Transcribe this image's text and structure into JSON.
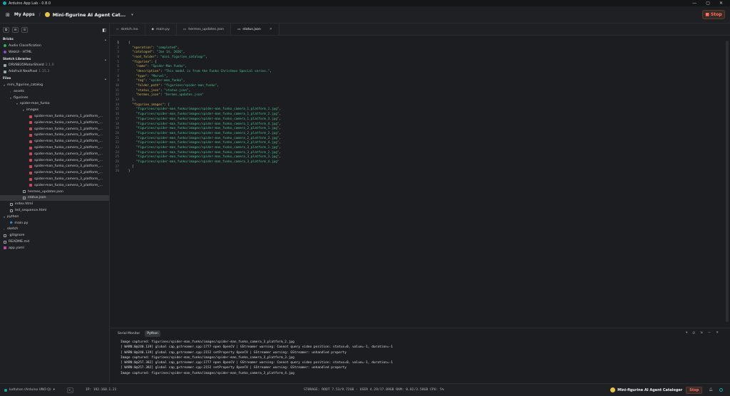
{
  "window": {
    "title": "Arduino App Lab - 0.8.0"
  },
  "appbar": {
    "my_apps": "My Apps",
    "separator": "/",
    "app_title": "Mini-figurine AI Agent Cat...",
    "stop_label": "Stop"
  },
  "sidebar": {
    "tools": [
      "⧉",
      "⊟",
      "⊡"
    ],
    "bricks_header": "Bricks",
    "bricks": [
      {
        "label": "Audio Classification",
        "color": "#2fb35c"
      },
      {
        "label": "WebUI - HTML",
        "color": "#8a4fd1"
      }
    ],
    "libraries_header": "Sketch Libraries",
    "libraries": [
      {
        "label": "DRV8835MotorShield",
        "version": "2.1.0"
      },
      {
        "label": "Adafruit NeoPixel",
        "version": "1.15.3"
      }
    ],
    "files_header": "Files",
    "tree": [
      {
        "label": "mini_figurine_catalog",
        "depth": 0,
        "toggle": "▾",
        "icon": "none"
      },
      {
        "label": "assets",
        "depth": 1,
        "toggle": "›",
        "icon": "none"
      },
      {
        "label": "figurines",
        "depth": 1,
        "toggle": "▾",
        "icon": "none"
      },
      {
        "label": "spider-man_funko",
        "depth": 2,
        "toggle": "▾",
        "icon": "none"
      },
      {
        "label": "images",
        "depth": 3,
        "toggle": "▾",
        "icon": "none"
      },
      {
        "label": "spider-man_funko_camera_1_platform_...",
        "depth": 4,
        "toggle": "",
        "icon": "img"
      },
      {
        "label": "spider-man_funko_camera_1_platform_...",
        "depth": 4,
        "toggle": "",
        "icon": "img"
      },
      {
        "label": "spider-man_funko_camera_1_platform_...",
        "depth": 4,
        "toggle": "",
        "icon": "img"
      },
      {
        "label": "spider-man_funko_camera_1_platform_...",
        "depth": 4,
        "toggle": "",
        "icon": "img"
      },
      {
        "label": "spider-man_funko_camera_2_platform_...",
        "depth": 4,
        "toggle": "",
        "icon": "img"
      },
      {
        "label": "spider-man_funko_camera_2_platform_...",
        "depth": 4,
        "toggle": "",
        "icon": "img"
      },
      {
        "label": "spider-man_funko_camera_2_platform_...",
        "depth": 4,
        "toggle": "",
        "icon": "img"
      },
      {
        "label": "spider-man_funko_camera_2_platform_...",
        "depth": 4,
        "toggle": "",
        "icon": "img"
      },
      {
        "label": "spider-man_funko_camera_3_platform_...",
        "depth": 4,
        "toggle": "",
        "icon": "img"
      },
      {
        "label": "spider-man_funko_camera_3_platform_...",
        "depth": 4,
        "toggle": "",
        "icon": "img"
      },
      {
        "label": "spider-man_funko_camera_3_platform_...",
        "depth": 4,
        "toggle": "",
        "icon": "img"
      },
      {
        "label": "spider-man_funko_camera_3_platform_...",
        "depth": 4,
        "toggle": "",
        "icon": "img"
      },
      {
        "label": "hermes_updates.json",
        "depth": 3,
        "toggle": "",
        "icon": "file"
      },
      {
        "label": "status.json",
        "depth": 3,
        "toggle": "",
        "icon": "file",
        "selected": true
      },
      {
        "label": "index.html",
        "depth": 1,
        "toggle": "",
        "icon": "file"
      },
      {
        "label": "led_sequence.html",
        "depth": 1,
        "toggle": "",
        "icon": "file"
      },
      {
        "label": "python",
        "depth": 0,
        "toggle": "▾",
        "icon": "none"
      },
      {
        "label": "main.py",
        "depth": 1,
        "toggle": "",
        "icon": "py"
      },
      {
        "label": "sketch",
        "depth": 0,
        "toggle": "›",
        "icon": "none"
      },
      {
        "label": ".gitignore",
        "depth": 0,
        "toggle": "",
        "icon": "file"
      },
      {
        "label": "README.md",
        "depth": 0,
        "toggle": "",
        "icon": "file"
      },
      {
        "label": "app.yaml",
        "depth": 0,
        "toggle": "",
        "icon": "yaml"
      }
    ]
  },
  "tabs": [
    {
      "label": "sketch.ino",
      "icon": "‹›",
      "active": false
    },
    {
      "label": "main.py",
      "icon": "◆",
      "active": false
    },
    {
      "label": "hermes_updates.json",
      "icon": "▭",
      "active": false
    },
    {
      "label": "status.json",
      "icon": "▭",
      "active": true
    }
  ],
  "code_lines": [
    [
      {
        "t": "{",
        "c": "p"
      }
    ],
    [
      {
        "t": "  ",
        "c": "p"
      },
      {
        "t": "\"operation\"",
        "c": "k"
      },
      {
        "t": ": ",
        "c": "p"
      },
      {
        "t": "\"completed\"",
        "c": "s"
      },
      {
        "t": ",",
        "c": "p"
      }
    ],
    [
      {
        "t": "  ",
        "c": "p"
      },
      {
        "t": "\"cataloged\"",
        "c": "k"
      },
      {
        "t": ": ",
        "c": "p"
      },
      {
        "t": "\"Jan 14, 2026\"",
        "c": "s"
      },
      {
        "t": ",",
        "c": "p"
      }
    ],
    [
      {
        "t": "  ",
        "c": "p"
      },
      {
        "t": "\"root_folder\"",
        "c": "k"
      },
      {
        "t": ": ",
        "c": "p"
      },
      {
        "t": "\"mini_figurine_catalog/\"",
        "c": "s"
      },
      {
        "t": ",",
        "c": "p"
      }
    ],
    [
      {
        "t": "  ",
        "c": "p"
      },
      {
        "t": "\"figurine\"",
        "c": "k"
      },
      {
        "t": ": {",
        "c": "p"
      }
    ],
    [
      {
        "t": "    ",
        "c": "p"
      },
      {
        "t": "\"name\"",
        "c": "k"
      },
      {
        "t": ": ",
        "c": "p"
      },
      {
        "t": "\"Spider-Man Funko\"",
        "c": "s"
      },
      {
        "t": ",",
        "c": "p"
      }
    ],
    [
      {
        "t": "    ",
        "c": "p"
      },
      {
        "t": "\"description\"",
        "c": "k"
      },
      {
        "t": ": ",
        "c": "p"
      },
      {
        "t": "\"This model is from the Funko Christmas Special series.\"",
        "c": "s"
      },
      {
        "t": ",",
        "c": "p"
      }
    ],
    [
      {
        "t": "    ",
        "c": "p"
      },
      {
        "t": "\"type\"",
        "c": "k"
      },
      {
        "t": ": ",
        "c": "p"
      },
      {
        "t": "\"Marvel\"",
        "c": "s"
      },
      {
        "t": ",",
        "c": "p"
      }
    ],
    [
      {
        "t": "    ",
        "c": "p"
      },
      {
        "t": "\"tag\"",
        "c": "k"
      },
      {
        "t": ": ",
        "c": "p"
      },
      {
        "t": "\"spider-man_funko\"",
        "c": "s"
      },
      {
        "t": ",",
        "c": "p"
      }
    ],
    [
      {
        "t": "    ",
        "c": "p"
      },
      {
        "t": "\"folder_path\"",
        "c": "k"
      },
      {
        "t": ": ",
        "c": "p"
      },
      {
        "t": "\"figurines/spider-man_funko\"",
        "c": "s"
      },
      {
        "t": ",",
        "c": "p"
      }
    ],
    [
      {
        "t": "    ",
        "c": "p"
      },
      {
        "t": "\"status_json\"",
        "c": "k"
      },
      {
        "t": ": ",
        "c": "p"
      },
      {
        "t": "\"status.json\"",
        "c": "s"
      },
      {
        "t": ",",
        "c": "p"
      }
    ],
    [
      {
        "t": "    ",
        "c": "p"
      },
      {
        "t": "\"hermes_json\"",
        "c": "k"
      },
      {
        "t": ": ",
        "c": "p"
      },
      {
        "t": "\"hermes_updates.json\"",
        "c": "s"
      }
    ],
    [
      {
        "t": "  },",
        "c": "p"
      }
    ],
    [
      {
        "t": "  ",
        "c": "p"
      },
      {
        "t": "\"figurine_images\"",
        "c": "k"
      },
      {
        "t": ": [",
        "c": "p"
      }
    ],
    [
      {
        "t": "    ",
        "c": "p"
      },
      {
        "t": "\"figurines/spider-man_funko/images/spider-man_funko_camera_1_platform_1.jpg\"",
        "c": "s"
      },
      {
        "t": ",",
        "c": "p"
      }
    ],
    [
      {
        "t": "    ",
        "c": "p"
      },
      {
        "t": "\"figurines/spider-man_funko/images/spider-man_funko_camera_1_platform_2.jpg\"",
        "c": "s"
      },
      {
        "t": ",",
        "c": "p"
      }
    ],
    [
      {
        "t": "    ",
        "c": "p"
      },
      {
        "t": "\"figurines/spider-man_funko/images/spider-man_funko_camera_1_platform_3.jpg\"",
        "c": "s"
      },
      {
        "t": ",",
        "c": "p"
      }
    ],
    [
      {
        "t": "    ",
        "c": "p"
      },
      {
        "t": "\"figurines/spider-man_funko/images/spider-man_funko_camera_1_platform_4.jpg\"",
        "c": "s"
      },
      {
        "t": ",",
        "c": "p"
      }
    ],
    [
      {
        "t": "    ",
        "c": "p"
      },
      {
        "t": "\"figurines/spider-man_funko/images/spider-man_funko_camera_2_platform_1.jpg\"",
        "c": "s"
      },
      {
        "t": ",",
        "c": "p"
      }
    ],
    [
      {
        "t": "    ",
        "c": "p"
      },
      {
        "t": "\"figurines/spider-man_funko/images/spider-man_funko_camera_2_platform_2.jpg\"",
        "c": "s"
      },
      {
        "t": ",",
        "c": "p"
      }
    ],
    [
      {
        "t": "    ",
        "c": "p"
      },
      {
        "t": "\"figurines/spider-man_funko/images/spider-man_funko_camera_2_platform_3.jpg\"",
        "c": "s"
      },
      {
        "t": ",",
        "c": "p"
      }
    ],
    [
      {
        "t": "    ",
        "c": "p"
      },
      {
        "t": "\"figurines/spider-man_funko/images/spider-man_funko_camera_2_platform_4.jpg\"",
        "c": "s"
      },
      {
        "t": ",",
        "c": "p"
      }
    ],
    [
      {
        "t": "    ",
        "c": "p"
      },
      {
        "t": "\"figurines/spider-man_funko/images/spider-man_funko_camera_3_platform_1.jpg\"",
        "c": "s"
      },
      {
        "t": ",",
        "c": "p"
      }
    ],
    [
      {
        "t": "    ",
        "c": "p"
      },
      {
        "t": "\"figurines/spider-man_funko/images/spider-man_funko_camera_3_platform_2.jpg\"",
        "c": "s"
      },
      {
        "t": ",",
        "c": "p"
      }
    ],
    [
      {
        "t": "    ",
        "c": "p"
      },
      {
        "t": "\"figurines/spider-man_funko/images/spider-man_funko_camera_3_platform_3.jpg\"",
        "c": "s"
      },
      {
        "t": ",",
        "c": "p"
      }
    ],
    [
      {
        "t": "    ",
        "c": "p"
      },
      {
        "t": "\"figurines/spider-man_funko/images/spider-man_funko_camera_3_platform_4.jpg\"",
        "c": "s"
      }
    ],
    [
      {
        "t": "  ]",
        "c": "p"
      }
    ],
    [
      {
        "t": "}",
        "c": "p"
      }
    ]
  ],
  "panel": {
    "tabs": [
      {
        "label": "Serial Monitor",
        "active": false
      },
      {
        "label": "Python",
        "active": true
      }
    ],
    "controls": [
      "▾",
      "⏱",
      "⇲",
      "—",
      "✕"
    ],
    "log": [
      "Image captured: figurines/spider-man_funko/images/spider-man_funko_camera_3_platform_2.jpg",
      "[ WARN:0@240.139] global cap_gstreamer.cpp:1777 open OpenCV | GStreamer warning: Cannot query video position: status=0, value=-1, duration=-1",
      "[ WARN:0@240.139] global cap_gstreamer.cpp:2152 setProperty OpenCV | GStreamer warning: GStreamer: unhandled property",
      "Image captured: figurines/spider-man_funko/images/spider-man_funko_camera_3_platform_3.jpg",
      "[ WARN:0@257.382] global cap_gstreamer.cpp:1777 open OpenCV | GStreamer warning: Cannot query video position: status=0, value=-1, duration=-1",
      "[ WARN:0@257.382] global cap_gstreamer.cpp:2152 setProperty OpenCV | GStreamer warning: GStreamer: unhandled property",
      "Image captured: figurines/spider-man_funko/images/spider-man_funko_camera_3_platform_4.jpg"
    ]
  },
  "statusbar": {
    "board": "kutluhan (Arduino UNO Q)",
    "ip": "IP: 192.168.1.21",
    "storage": "STORAGE: ROOT 7.53/9.72GB · USER 4.29/17.89GB   RAM: 0.82/3.58GB   CPU: 5%",
    "app_name": "Mini-figurine AI Agent Cataloger",
    "stop_label": "Stop"
  },
  "colors": {
    "accent": "#15a8a8",
    "stop": "#ff7060",
    "json_key": "#d6b45a",
    "json_string": "#4fc08d"
  }
}
